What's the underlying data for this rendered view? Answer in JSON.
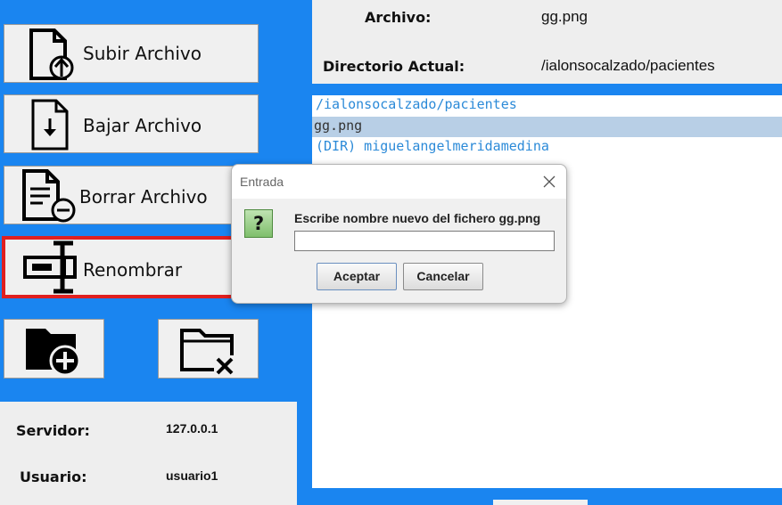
{
  "left": {
    "upload_label": "Subir Archivo",
    "download_label": "Bajar Archivo",
    "delete_label": "Borrar Archivo",
    "rename_label": "Renombrar",
    "server_label": "Servidor:",
    "server_value": "127.0.0.1",
    "user_label": "Usuario:",
    "user_value": "usuario1"
  },
  "header": {
    "file_label": "Archivo:",
    "file_value": "gg.png",
    "dir_label": "Directorio Actual:",
    "dir_value": "/ialonsocalzado/pacientes"
  },
  "file_list": [
    "/ialonsocalzado/pacientes",
    "gg.png",
    "(DIR) miguelangelmeridamedina"
  ],
  "dialog": {
    "title": "Entrada",
    "message": "Escribe nombre nuevo del fichero gg.png",
    "input_value": "",
    "ok_label": "Aceptar",
    "cancel_label": "Cancelar"
  },
  "colors": {
    "background": "#1a85f0",
    "list_text": "#2b8ad8",
    "selected_row": "#b8cfe6",
    "rename_highlight": "#e02020"
  }
}
